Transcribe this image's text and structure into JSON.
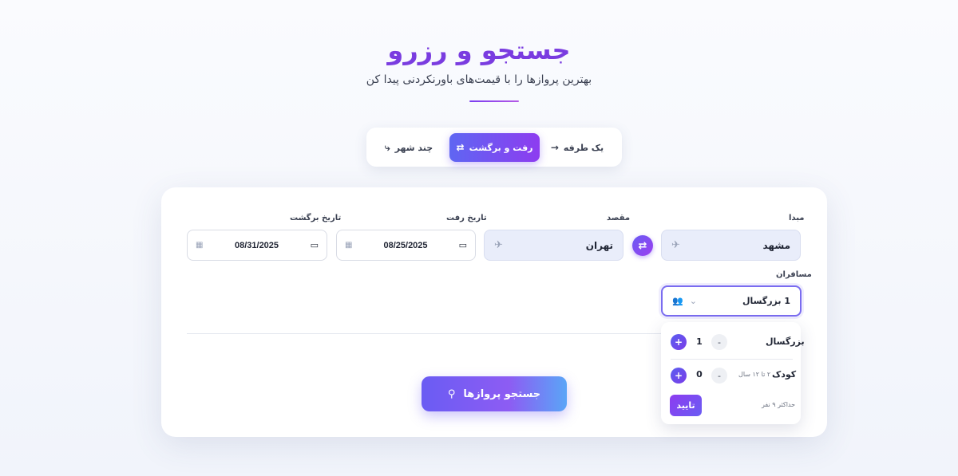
{
  "hero": {
    "title": "جستجو و رزرو",
    "subtitle": "بهترین پروازها را با قیمت‌های باورنکردنی پیدا کن"
  },
  "trip_tabs": {
    "one_way": "یک طرفه",
    "round_trip": "رفت و برگشت",
    "multi_city": "چند شهر",
    "active": "round_trip"
  },
  "form": {
    "origin": {
      "label": "مبدا",
      "value": "مشهد"
    },
    "destination": {
      "label": "مقصد",
      "value": "تهران"
    },
    "departure_date": {
      "label": "تاریخ رفت",
      "value": "08/25/2025"
    },
    "return_date": {
      "label": "تاریخ برگشت",
      "value": "08/31/2025"
    },
    "passengers": {
      "label": "مسافران",
      "value": "1 بزرگسال"
    },
    "search_button": "جستجو پروازها"
  },
  "passenger_panel": {
    "adult_label": "بزرگسال",
    "adult_count": "1",
    "child_label": "کودک",
    "child_age": "۲ تا ۱۲ سال",
    "child_count": "0",
    "minus": "-",
    "plus": "+",
    "max_note": "حداکثر ۹ نفر",
    "confirm": "تایید"
  },
  "colors": {
    "accent": "#7a3ce0",
    "gradient_start": "#5f66f2",
    "gradient_end": "#8d3cf0"
  }
}
